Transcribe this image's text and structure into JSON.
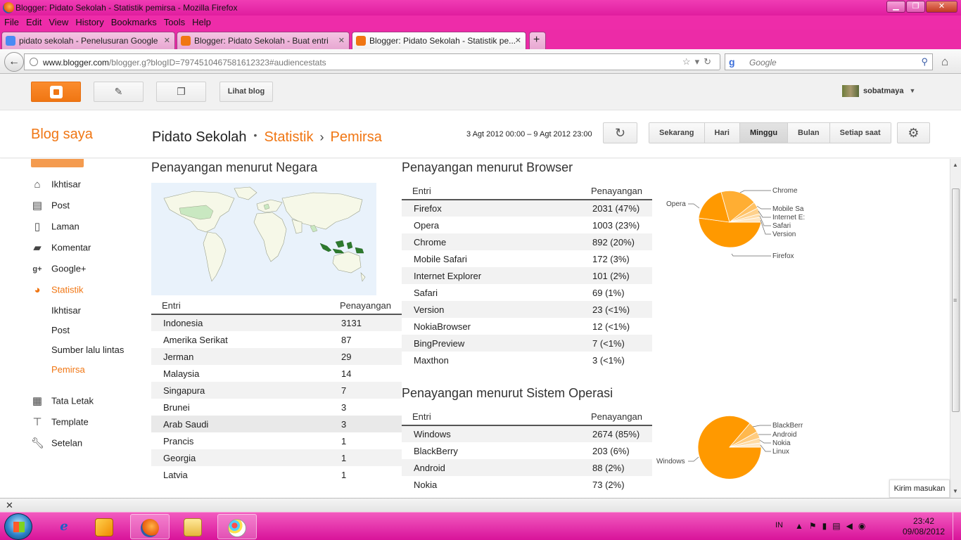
{
  "window": {
    "title": "Blogger: Pidato Sekolah - Statistik pemirsa - Mozilla Firefox",
    "min_label": "▁",
    "max_label": "❐",
    "close_label": "✕"
  },
  "menu": [
    "File",
    "Edit",
    "View",
    "History",
    "Bookmarks",
    "Tools",
    "Help"
  ],
  "tabs": [
    {
      "label": "pidato sekolah - Penelusuran Google",
      "icon": "google-icon",
      "color": "#4a8af4"
    },
    {
      "label": "Blogger: Pidato Sekolah - Buat entri",
      "icon": "blogger-icon",
      "color": "#f07613"
    },
    {
      "label": "Blogger: Pidato Sekolah - Statistik pe...",
      "icon": "blogger-icon",
      "color": "#f07613"
    }
  ],
  "newtab_label": "+",
  "address": {
    "domain": "www.blogger.com",
    "path": "/blogger.g?blogID=7974510467581612323#audiencestats"
  },
  "search": {
    "engine": "g",
    "placeholder": "Google"
  },
  "header": {
    "view_blog": "Lihat blog",
    "username": "sobatmaya"
  },
  "subheader": {
    "blog_saya": "Blog saya",
    "blog_name": "Pidato Sekolah",
    "section": "Statistik",
    "page": "Pemirsa",
    "date_range": "3 Agt 2012 00:00 – 9 Agt 2012 23:00",
    "ranges": [
      "Sekarang",
      "Hari",
      "Minggu",
      "Bulan",
      "Setiap saat"
    ],
    "selected_range": "Minggu"
  },
  "sidebar": {
    "items": [
      {
        "label": "Ikhtisar",
        "icon": "home-icon"
      },
      {
        "label": "Post",
        "icon": "post-icon"
      },
      {
        "label": "Laman",
        "icon": "page-icon"
      },
      {
        "label": "Komentar",
        "icon": "comment-icon"
      },
      {
        "label": "Google+",
        "icon": "googleplus-icon"
      },
      {
        "label": "Statistik",
        "icon": "stats-icon"
      }
    ],
    "sub_items": [
      "Ikhtisar",
      "Post",
      "Sumber lalu lintas",
      "Pemirsa"
    ],
    "items2": [
      {
        "label": "Tata Letak",
        "icon": "layout-icon"
      },
      {
        "label": "Template",
        "icon": "template-icon"
      },
      {
        "label": "Setelan",
        "icon": "wrench-icon"
      }
    ]
  },
  "country": {
    "title": "Penayangan menurut Negara",
    "col1": "Entri",
    "col2": "Penayangan",
    "rows": [
      [
        "Indonesia",
        "3131"
      ],
      [
        "Amerika Serikat",
        "87"
      ],
      [
        "Jerman",
        "29"
      ],
      [
        "Malaysia",
        "14"
      ],
      [
        "Singapura",
        "7"
      ],
      [
        "Brunei",
        "3"
      ],
      [
        "Arab Saudi",
        "3"
      ],
      [
        "Prancis",
        "1"
      ],
      [
        "Georgia",
        "1"
      ],
      [
        "Latvia",
        "1"
      ]
    ]
  },
  "browser": {
    "title": "Penayangan menurut Browser",
    "col1": "Entri",
    "col2": "Penayangan",
    "rows": [
      [
        "Firefox",
        "2031 (47%)"
      ],
      [
        "Opera",
        "1003 (23%)"
      ],
      [
        "Chrome",
        "892 (20%)"
      ],
      [
        "Mobile Safari",
        "172 (3%)"
      ],
      [
        "Internet Explorer",
        "101 (2%)"
      ],
      [
        "Safari",
        "69 (1%)"
      ],
      [
        "Version",
        "23 (<1%)"
      ],
      [
        "NokiaBrowser",
        "12 (<1%)"
      ],
      [
        "BingPreview",
        "7 (<1%)"
      ],
      [
        "Maxthon",
        "3 (<1%)"
      ]
    ],
    "pie_labels": [
      "Chrome",
      "Mobile Sa",
      "Internet E:",
      "Safari",
      "Version",
      "Opera",
      "Firefox"
    ]
  },
  "os": {
    "title": "Penayangan menurut Sistem Operasi",
    "col1": "Entri",
    "col2": "Penayangan",
    "rows": [
      [
        "Windows",
        "2674 (85%)"
      ],
      [
        "BlackBerry",
        "203 (6%)"
      ],
      [
        "Android",
        "88 (2%)"
      ],
      [
        "Nokia",
        "73 (2%)"
      ]
    ],
    "pie_labels": [
      "BlackBerr",
      "Android",
      "Nokia",
      "Linux",
      "Windows"
    ]
  },
  "feedback": "Kirim masukan",
  "taskbar": {
    "lang": "IN",
    "time": "23:42",
    "date": "09/08/2012"
  },
  "colors": {
    "accent": "#f07613",
    "pie_main": "#ff9900",
    "titlebar": "#e01d9f"
  }
}
